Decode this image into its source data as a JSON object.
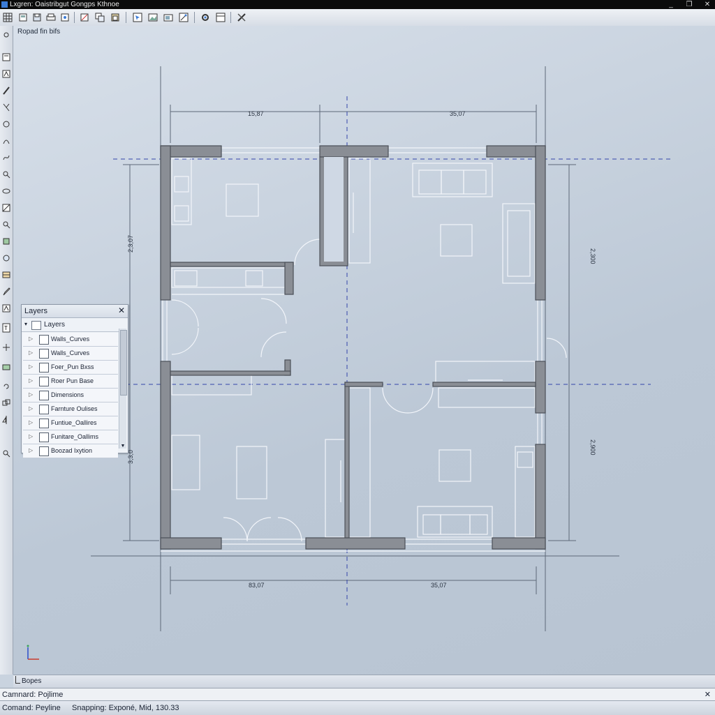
{
  "window": {
    "title": "Lxgren: Oaistribgut Gongps Kthnoe",
    "buttons": [
      "_",
      "❐",
      "✕"
    ]
  },
  "canvas": {
    "viewport_label": "Ropad fin bifs",
    "dimensions": {
      "top_left": "15,87",
      "top_right": "35,07",
      "bottom_left": "83,07",
      "bottom_right": "35,07",
      "left_upper": "2,3,07",
      "left_lower": "3,3,0",
      "right_upper": "2,300",
      "right_lower": "2,900"
    },
    "colors": {
      "wall": "#8a8e95",
      "wall_edge": "#4a4f57",
      "line": "#eef2f8",
      "dim": "#55606e",
      "axis": "#3344aa"
    }
  },
  "layers_panel": {
    "title": "Layers",
    "header": "Layers",
    "rows": [
      "Walls_Curves",
      "Walls_Curves",
      "Foer_Pun Bxss",
      "Roer Pun Base",
      "Dimensions",
      "Farnture Oulises",
      "Funtiue_Oallires",
      "Funitare_Oallims",
      "Boozad Ixytion"
    ]
  },
  "tabs": {
    "active": "Bopes"
  },
  "command_line": {
    "text": "Camnard: Pojlime"
  },
  "status": {
    "command": "Comand: Peyline",
    "snapping": "Snapping: Exponé, Mid, 130.33"
  }
}
